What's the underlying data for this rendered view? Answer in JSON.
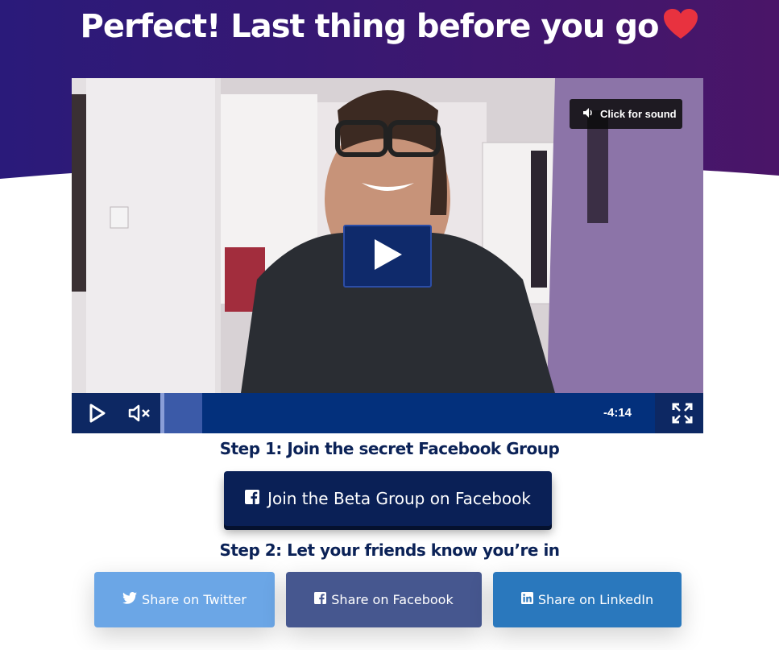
{
  "header": {
    "title": "Perfect! Last thing before you go",
    "heart_icon": "heart-icon",
    "colors": {
      "gradient_start": "#2a1a7a",
      "gradient_end": "#4a1568",
      "heart": "#e8323f"
    }
  },
  "video": {
    "sound_button_label": "Click for sound",
    "sound_icon": "speaker-icon",
    "play_icon": "play-icon",
    "mute_icon": "mute-icon",
    "fullscreen_icon": "fullscreen-icon",
    "time_remaining": "-4:14",
    "colors": {
      "control_bar": "#0d2863",
      "big_play": "#0f2a6b"
    }
  },
  "step1": {
    "title": "Step 1: Join the secret Facebook Group",
    "button_label": "Join the Beta Group on Facebook",
    "button_icon": "facebook-icon"
  },
  "step2": {
    "title": "Step 2: Let your friends know you’re in",
    "share_buttons": [
      {
        "label": "Share on Twitter",
        "icon": "twitter-icon",
        "color": "#6ba6e6"
      },
      {
        "label": "Share on Facebook",
        "icon": "facebook-icon",
        "color": "#46578f"
      },
      {
        "label": "Share on LinkedIn",
        "icon": "linkedin-icon",
        "color": "#2a78bd"
      }
    ]
  }
}
